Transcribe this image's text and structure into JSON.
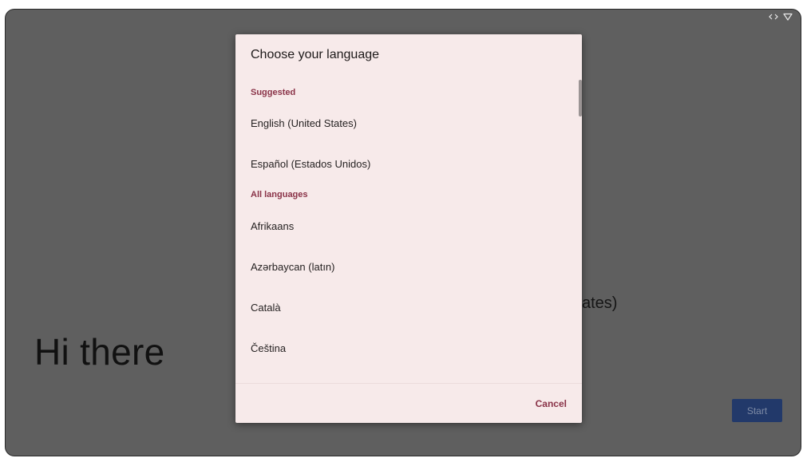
{
  "background": {
    "greeting": "Hi there",
    "selected_language_partial": "ates)",
    "start_label": "Start"
  },
  "dialog": {
    "title": "Choose your language",
    "suggested_header": "Suggested",
    "suggested": [
      "English (United States)",
      "Español (Estados Unidos)"
    ],
    "all_header": "All languages",
    "all": [
      "Afrikaans",
      "Azərbaycan (latın)",
      "Català",
      "Čeština"
    ],
    "cancel_label": "Cancel"
  },
  "colors": {
    "accent": "#8a3348",
    "dialog_bg": "#f7eaea",
    "scrim": "#5f5f5f",
    "start_button": "#22396a"
  },
  "icons": [
    "code-arrows-icon",
    "wifi-icon"
  ]
}
